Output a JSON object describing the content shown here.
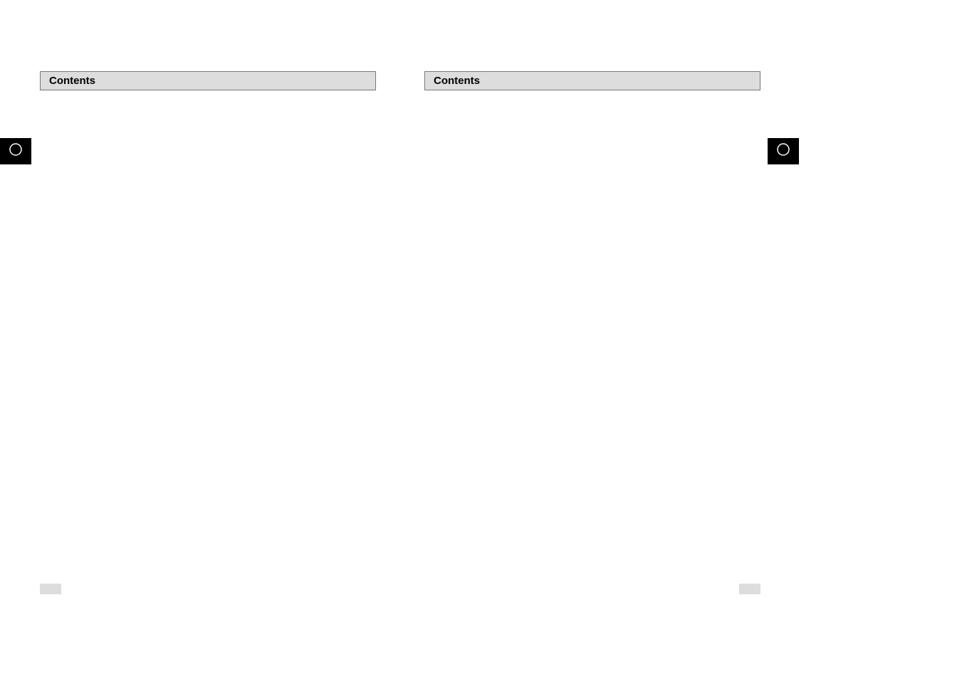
{
  "pages": [
    {
      "contentsLabel": "Contents"
    },
    {
      "contentsLabel": "Contents"
    }
  ]
}
